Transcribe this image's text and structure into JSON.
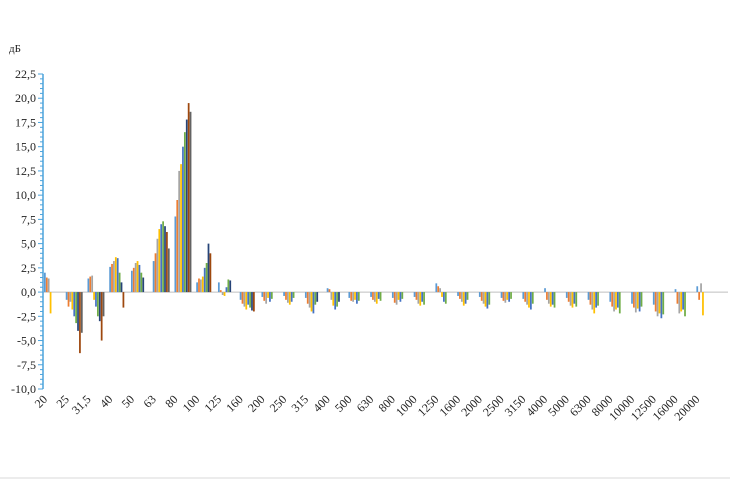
{
  "chart_data": {
    "type": "bar",
    "ylabel": "дБ",
    "ylim": [
      -10,
      22.5
    ],
    "ytick_step": 2.5,
    "yticks": [
      "22,5",
      "20,0",
      "17,5",
      "15,0",
      "12,5",
      "10,0",
      "7,5",
      "5,0",
      "2,5",
      "0,0",
      "-2,5",
      "-5,0",
      "-7,5",
      "-10,0"
    ],
    "categories": [
      "20",
      "25",
      "31,5",
      "40",
      "50",
      "63",
      "80",
      "100",
      "125",
      "160",
      "200",
      "250",
      "315",
      "400",
      "500",
      "630",
      "800",
      "1000",
      "1250",
      "1600",
      "2000",
      "2500",
      "3150",
      "4000",
      "5000",
      "6300",
      "8000",
      "10000",
      "12500",
      "16000",
      "20000"
    ],
    "colors": [
      "#5b9bd5",
      "#ed7d31",
      "#a5a5a5",
      "#ffc000",
      "#4472c4",
      "#70ad47",
      "#264478",
      "#9e480e",
      "#636363",
      "#997300",
      "#255e91",
      "#43682b"
    ],
    "category_values": [
      [
        2.0,
        1.5,
        1.4,
        -2.2
      ],
      [
        -0.8,
        -1.5,
        -1.0,
        -1.8,
        -2.5,
        -3.2,
        -4.0,
        -6.3,
        -4.2
      ],
      [
        1.4,
        1.6,
        1.7,
        -0.8,
        -1.5,
        -2.5,
        -3.0,
        -5.0,
        -2.5
      ],
      [
        2.6,
        2.9,
        3.2,
        3.6,
        3.5,
        2.0,
        1.0,
        -1.6
      ],
      [
        2.2,
        2.5,
        3.0,
        3.2,
        2.8,
        2.0,
        1.5
      ],
      [
        3.2,
        4.0,
        5.5,
        6.5,
        7.0,
        7.3,
        6.8,
        6.2,
        4.5
      ],
      [
        7.8,
        9.5,
        12.5,
        13.2,
        15.0,
        16.5,
        17.8,
        19.5,
        18.6
      ],
      [
        1.0,
        1.4,
        1.3,
        1.6,
        2.5,
        3.0,
        5.0,
        4.0
      ],
      [
        1.0,
        0.2,
        -0.3,
        -0.4,
        0.5,
        1.3,
        1.2
      ],
      [
        -0.8,
        -1.2,
        -1.5,
        -1.8,
        -1.3,
        -1.6,
        -1.9,
        -2.0
      ],
      [
        -0.5,
        -0.9,
        -1.2,
        -0.6,
        -1.0,
        -0.7
      ],
      [
        -0.4,
        -0.8,
        -1.1,
        -1.3,
        -1.0,
        -0.6
      ],
      [
        -0.6,
        -1.2,
        -1.6,
        -2.0,
        -2.2,
        -1.3,
        -1.0
      ],
      [
        0.4,
        0.3,
        -0.8,
        -1.4,
        -1.8,
        -1.5,
        -1.0
      ],
      [
        -0.6,
        -0.9,
        -1.0,
        -0.8,
        -1.2,
        -0.9
      ],
      [
        -0.5,
        -0.8,
        -1.0,
        -1.2,
        -0.7,
        -0.9
      ],
      [
        -0.6,
        -1.1,
        -1.3,
        -0.8,
        -1.0,
        -0.7
      ],
      [
        -0.5,
        -0.8,
        -1.2,
        -1.4,
        -1.0,
        -1.3
      ],
      [
        0.9,
        0.6,
        0.4,
        -0.5,
        -1.0,
        -1.2
      ],
      [
        -0.4,
        -0.7,
        -1.0,
        -1.4,
        -1.2,
        -0.8
      ],
      [
        -0.5,
        -0.9,
        -1.2,
        -1.5,
        -1.7,
        -1.3
      ],
      [
        -0.6,
        -0.9,
        -1.1,
        -0.8,
        -1.0,
        -0.7
      ],
      [
        -0.7,
        -1.0,
        -1.3,
        -1.6,
        -1.8,
        -1.2
      ],
      [
        0.4,
        -0.8,
        -1.2,
        -1.5,
        -1.3,
        -1.6
      ],
      [
        -0.6,
        -1.0,
        -1.4,
        -1.6,
        -1.2,
        -1.5
      ],
      [
        -0.8,
        -1.3,
        -1.8,
        -2.2,
        -1.6,
        -1.4
      ],
      [
        -1.0,
        -1.5,
        -2.0,
        -1.8,
        -1.6,
        -2.2
      ],
      [
        -1.2,
        -1.6,
        -2.1,
        -1.7,
        -2.0,
        -1.5
      ],
      [
        -1.3,
        -2.0,
        -2.5,
        -2.2,
        -2.7,
        -2.3
      ],
      [
        0.3,
        -1.2,
        -2.2,
        -2.0,
        -1.8,
        -2.5
      ],
      [
        0.6,
        -0.8,
        0.9,
        -2.4
      ]
    ]
  }
}
